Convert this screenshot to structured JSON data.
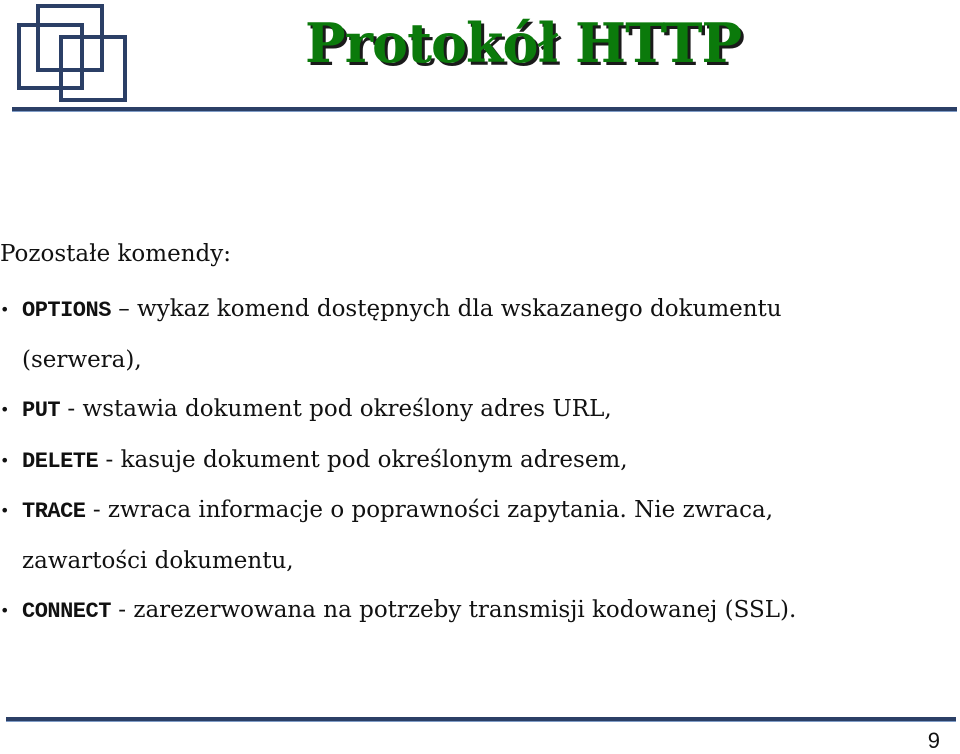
{
  "slide": {
    "title": "Protokół HTTP",
    "intro": "Pozostałe komendy:",
    "bullets": [
      {
        "command": "OPTIONS",
        "separator": " – ",
        "text": "wykaz komend dostępnych dla wskazanego dokumentu",
        "continuation": "(serwera),"
      },
      {
        "command": "PUT",
        "separator": " - ",
        "text": "wstawia dokument pod określony adres URL,"
      },
      {
        "command": "DELETE",
        "separator": " - ",
        "text": "kasuje dokument pod określonym adresem,"
      },
      {
        "command": "TRACE",
        "separator": " - ",
        "text": "zwraca informacje o poprawności zapytania. Nie zwraca,",
        "continuation": "zawartości dokumentu,"
      },
      {
        "command": "CONNECT",
        "separator": " - ",
        "text": "zarezerwowana na potrzeby transmisji kodowanej (SSL)."
      }
    ],
    "page_number": "9"
  },
  "colors": {
    "title": "#0b7a0b",
    "title_shadow": "#1a1a1a",
    "accent": "#2b3f66"
  },
  "icons": {
    "logo": "overlapping-squares-logo",
    "bullet": "•"
  }
}
